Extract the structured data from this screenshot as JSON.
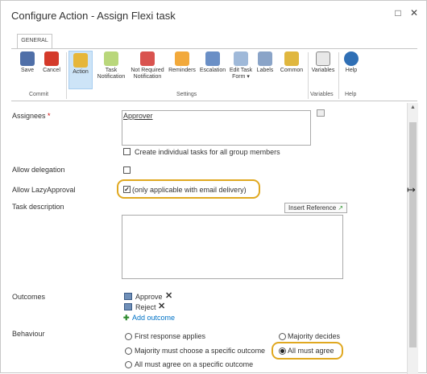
{
  "window": {
    "title": "Configure Action - Assign Flexi task"
  },
  "ribbon": {
    "tab": "GENERAL",
    "buttons": {
      "save": "Save",
      "cancel": "Cancel",
      "action": "Action",
      "task_notification": "Task Notification",
      "not_required_notification": "Not Required Notification",
      "reminders": "Reminders",
      "escalation": "Escalation",
      "edit_task_form": "Edit Task Form ▾",
      "labels": "Labels",
      "common": "Common",
      "variables": "Variables",
      "help": "Help"
    },
    "groups": {
      "commit": "Commit",
      "settings": "Settings",
      "variables": "Variables",
      "help": "Help"
    }
  },
  "form": {
    "assignees": {
      "label": "Assignees",
      "required_mark": "*",
      "value": "Approver",
      "group_option": "Create individual tasks for all group members"
    },
    "allow_delegation": {
      "label": "Allow delegation"
    },
    "allow_lazy_approval": {
      "label": "Allow LazyApproval",
      "checked": true,
      "note": "(only applicable with email delivery)"
    },
    "task_description": {
      "label": "Task description",
      "insert_reference": "Insert Reference"
    },
    "outcomes": {
      "label": "Outcomes",
      "items": [
        "Approve",
        "Reject"
      ],
      "add_link": "Add outcome"
    },
    "behaviour": {
      "label": "Behaviour",
      "options": {
        "first_response": "First response applies",
        "majority_decides": "Majority decides",
        "majority_specific": "Majority must choose a specific outcome",
        "all_must_agree": "All must agree",
        "all_specific": "All must agree on a specific outcome"
      },
      "selected": "All must agree"
    }
  },
  "colors": {
    "highlight": "#e0a820",
    "link": "#0072c6",
    "active_button": "#cde4f7"
  }
}
